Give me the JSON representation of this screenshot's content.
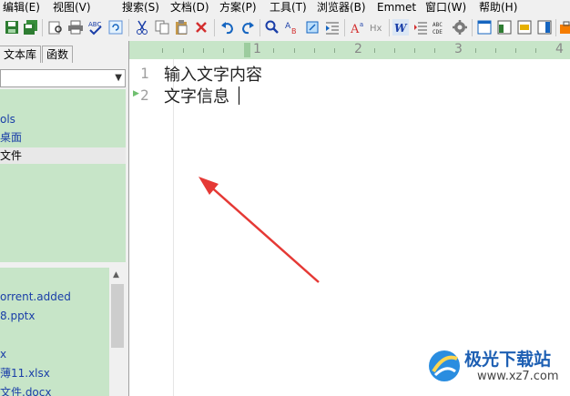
{
  "menu": [
    "编辑(E)",
    "视图(V)",
    "搜索(S)",
    "文档(D)",
    "方案(P)",
    "工具(T)",
    "浏览器(B)",
    "Emmet",
    "窗口(W)",
    "帮助(H)"
  ],
  "toolbar": {
    "icons": [
      "save-icon",
      "save-all-icon",
      "print-preview-icon",
      "print-icon",
      "spellcheck-icon",
      "refresh-icon",
      "cut-icon",
      "copy-icon",
      "paste-icon",
      "delete-icon",
      "undo-icon",
      "redo-icon",
      "find-icon",
      "replace-icon",
      "open-file-icon",
      "indent-icon",
      "font-size-icon",
      "hx-icon",
      "word-wrap-icon",
      "line-spacing-icon",
      "ruler-icon",
      "settings-icon",
      "panel-icon",
      "panel2-icon",
      "panel3-icon",
      "panel4-icon",
      "tools-icon"
    ],
    "hx_label": "Hx",
    "abc_top": "ABC",
    "abc_bottom": "CDE"
  },
  "left_panel": {
    "tabs": [
      "文本库",
      "函数"
    ],
    "dropdown_value": "",
    "tree_items": [
      {
        "label": "ols",
        "selected": false
      },
      {
        "label": "桌面",
        "selected": false
      },
      {
        "label": "文件",
        "selected": true
      }
    ],
    "files": [
      "orrent.added",
      "8.pptx",
      "",
      "x",
      "薄11.xlsx",
      "文件.docx"
    ]
  },
  "ruler": {
    "numbers": [
      "1",
      "2",
      "3",
      "4"
    ]
  },
  "editor": {
    "lines": [
      {
        "number": "1",
        "text": "输入文字内容"
      },
      {
        "number": "2",
        "text": "文字信息"
      }
    ]
  },
  "watermark": {
    "name": "极光下载站",
    "url": "www.xz7.com"
  },
  "colors": {
    "panel_green": "#c7e5c8",
    "link_blue": "#1a3ea8",
    "arrow_red": "#e53935"
  }
}
